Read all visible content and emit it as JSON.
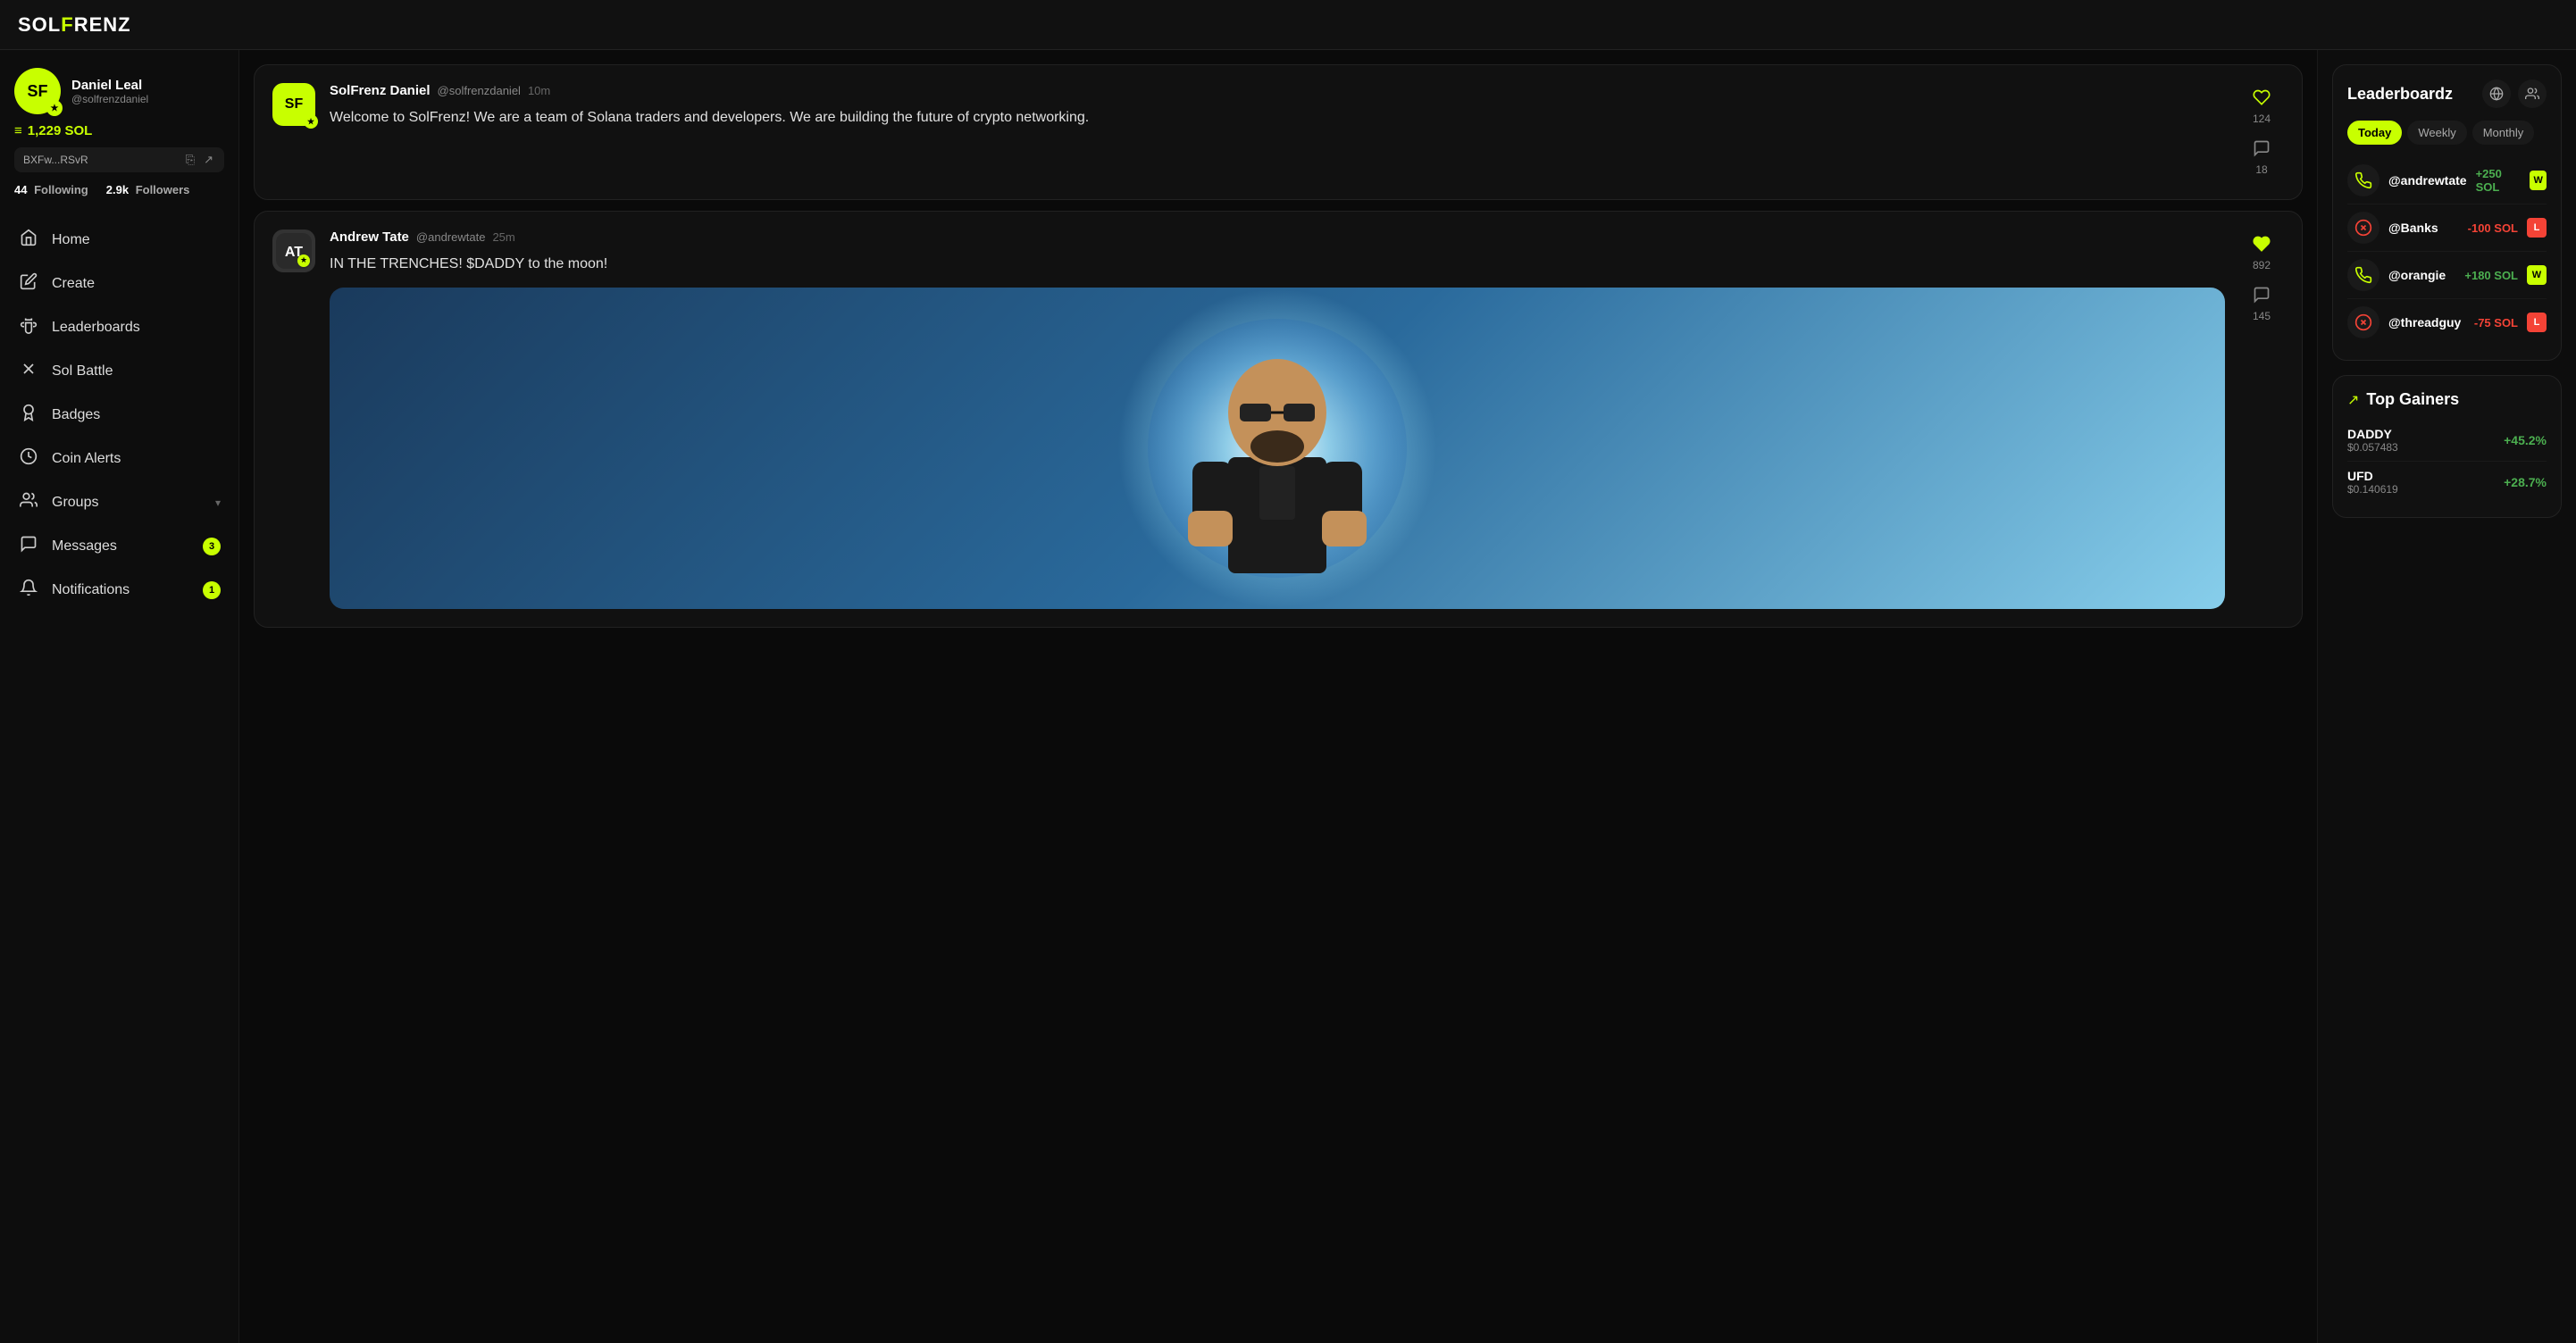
{
  "topbar": {
    "logo": "SOLFrenz"
  },
  "sidebar": {
    "profile": {
      "name": "Daniel Leal",
      "handle": "@solfrenzdaniel",
      "avatar_initials": "SF",
      "balance": "1,229 SOL",
      "wallet_address": "BXFw...RSvR",
      "following_count": "44",
      "following_label": "Following",
      "followers_count": "2.9k",
      "followers_label": "Followers"
    },
    "nav_items": [
      {
        "id": "home",
        "label": "Home",
        "icon": "🏠",
        "badge": null
      },
      {
        "id": "create",
        "label": "Create",
        "icon": "✏️",
        "badge": null
      },
      {
        "id": "leaderboards",
        "label": "Leaderboards",
        "icon": "🏆",
        "badge": null
      },
      {
        "id": "sol-battle",
        "label": "Sol Battle",
        "icon": "⚔️",
        "badge": null
      },
      {
        "id": "badges",
        "label": "Badges",
        "icon": "🎖️",
        "badge": null
      },
      {
        "id": "coin-alerts",
        "label": "Coin Alerts",
        "icon": "🔔",
        "badge": null
      },
      {
        "id": "groups",
        "label": "Groups",
        "icon": "👥",
        "badge": null,
        "has_arrow": true
      },
      {
        "id": "messages",
        "label": "Messages",
        "icon": "💬",
        "badge": "3"
      },
      {
        "id": "notifications",
        "label": "Notifications",
        "icon": "🔔",
        "badge": "1"
      }
    ]
  },
  "feed": {
    "posts": [
      {
        "id": "post1",
        "author_name": "SolFrenz Daniel",
        "author_handle": "@solfrenzdaniel",
        "time_ago": "10m",
        "avatar_initials": "SF",
        "text": "Welcome to SolFrenz! We are a team of Solana traders and developers. We are building the future of crypto networking.",
        "likes": 124,
        "comments": 18,
        "has_image": false
      },
      {
        "id": "post2",
        "author_name": "Andrew Tate",
        "author_handle": "@andrewtate",
        "time_ago": "25m",
        "avatar_initials": "AT",
        "text": "IN THE TRENCHES! $DADDY to the moon!",
        "likes": 892,
        "comments": 145,
        "has_image": true
      }
    ]
  },
  "leaderboard": {
    "title": "Leaderboardz",
    "tabs": [
      "Today",
      "Weekly",
      "Monthly"
    ],
    "active_tab": "Today",
    "entries": [
      {
        "handle": "@andrewtate",
        "sol": "+250 SOL",
        "positive": true,
        "badge": "W"
      },
      {
        "handle": "@Banks",
        "sol": "-100 SOL",
        "positive": false,
        "badge": "L"
      },
      {
        "handle": "@orangie",
        "sol": "+180 SOL",
        "positive": true,
        "badge": "W"
      },
      {
        "handle": "@threadguy",
        "sol": "-75 SOL",
        "positive": false,
        "badge": "L"
      }
    ]
  },
  "top_gainers": {
    "title": "Top Gainers",
    "items": [
      {
        "name": "DADDY",
        "price": "$0.057483",
        "pct": "+45.2%",
        "positive": true
      },
      {
        "name": "UFD",
        "price": "$0.140619",
        "pct": "+28.7%",
        "positive": true
      }
    ]
  }
}
